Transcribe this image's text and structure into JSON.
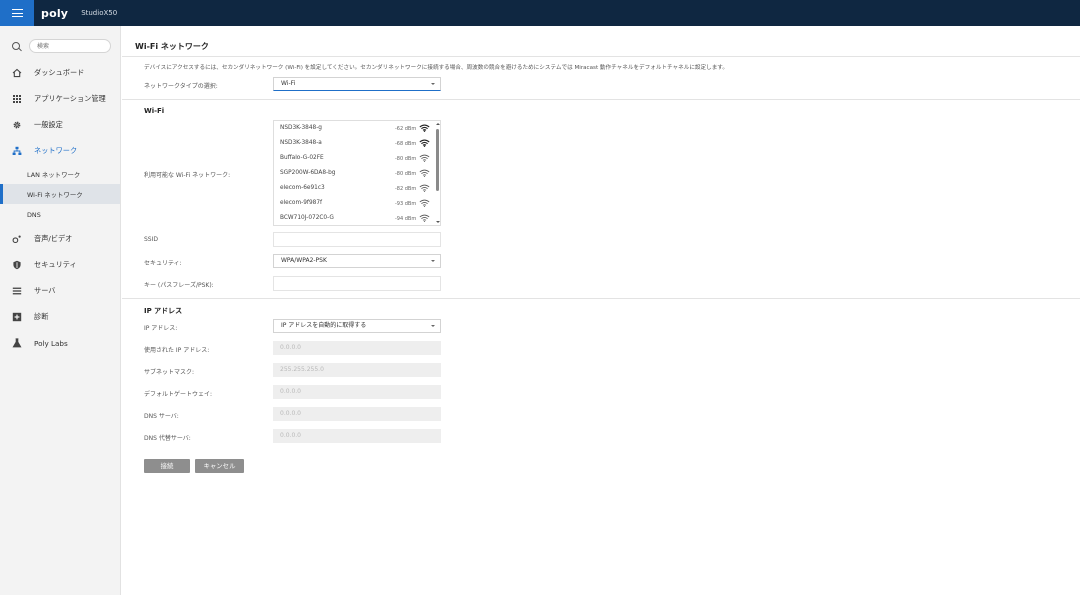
{
  "topbar": {
    "logo": "poly",
    "device_name": "StudioX50"
  },
  "sidebar": {
    "search_placeholder": "検索",
    "items": [
      {
        "label": "ダッシュボード",
        "icon": "home-icon"
      },
      {
        "label": "アプリケーション管理",
        "icon": "apps-grid-icon"
      },
      {
        "label": "一般設定",
        "icon": "gear-icon"
      },
      {
        "label": "ネットワーク",
        "icon": "network-icon"
      },
      {
        "label": "音声/ビデオ",
        "icon": "audio-video-icon"
      },
      {
        "label": "セキュリティ",
        "icon": "shield-icon"
      },
      {
        "label": "サーバ",
        "icon": "server-icon"
      },
      {
        "label": "診断",
        "icon": "diagnostics-icon"
      },
      {
        "label": "Poly Labs",
        "icon": "flask-icon"
      }
    ],
    "network_sub": [
      {
        "label": "LAN ネットワーク"
      },
      {
        "label": "Wi-Fi ネットワーク"
      },
      {
        "label": "DNS"
      }
    ]
  },
  "main": {
    "title": "Wi-Fi ネットワーク",
    "description": "デバイスにアクセスするには、セカンダリネットワーク (Wi-Fi) を設定してください。セカンダリネットワークに接続する場合、周波数の競合を避けるためにシステムでは Miracast 動作チャネルをデフォルトチャネルに設定します。",
    "network_type_label": "ネットワークタイプの選択:",
    "network_type_value": "Wi-Fi",
    "wifi_section": "Wi-Fi",
    "available_networks_label": "利用可能な Wi-Fi ネットワーク:",
    "networks": [
      {
        "ssid": "NSD3K-3848-g",
        "signal": "-62 dBm",
        "bars": 3
      },
      {
        "ssid": "NSD3K-3848-a",
        "signal": "-68 dBm",
        "bars": 3
      },
      {
        "ssid": "Buffalo-G-02FE",
        "signal": "-80 dBm",
        "bars": 2
      },
      {
        "ssid": "SGP200W-6DA8-bg",
        "signal": "-80 dBm",
        "bars": 2
      },
      {
        "ssid": "elecom-6e91c3",
        "signal": "-82 dBm",
        "bars": 2
      },
      {
        "ssid": "elecom-9f987f",
        "signal": "-93 dBm",
        "bars": 1
      },
      {
        "ssid": "BCW710J-072C0-G",
        "signal": "-94 dBm",
        "bars": 1
      }
    ],
    "ssid_label": "SSID",
    "ssid_value": "",
    "security_label": "セキュリティ:",
    "security_value": "WPA/WPA2-PSK",
    "key_label": "キー (パスフレーズ/PSK):",
    "key_value": "",
    "ip_section": "IP アドレス",
    "ip_address_label": "IP アドレス:",
    "ip_address_value": "IP アドレスを自動的に取得する",
    "used_ip_label": "使用された IP アドレス:",
    "used_ip_value": "0.0.0.0",
    "subnet_label": "サブネットマスク:",
    "subnet_value": "255.255.255.0",
    "gateway_label": "デフォルトゲートウェイ:",
    "gateway_value": "0.0.0.0",
    "dns_label": "DNS サーバ:",
    "dns_value": "0.0.0.0",
    "dns_alt_label": "DNS 代替サーバ:",
    "dns_alt_value": "0.0.0.0",
    "connect_button": "接続",
    "cancel_button": "キャンセル"
  },
  "colors": {
    "topbar_bg": "#0f2741",
    "accent": "#1f6fc8",
    "sidebar_bg": "#f3f3f3",
    "button_bg": "#8e8e8e"
  }
}
